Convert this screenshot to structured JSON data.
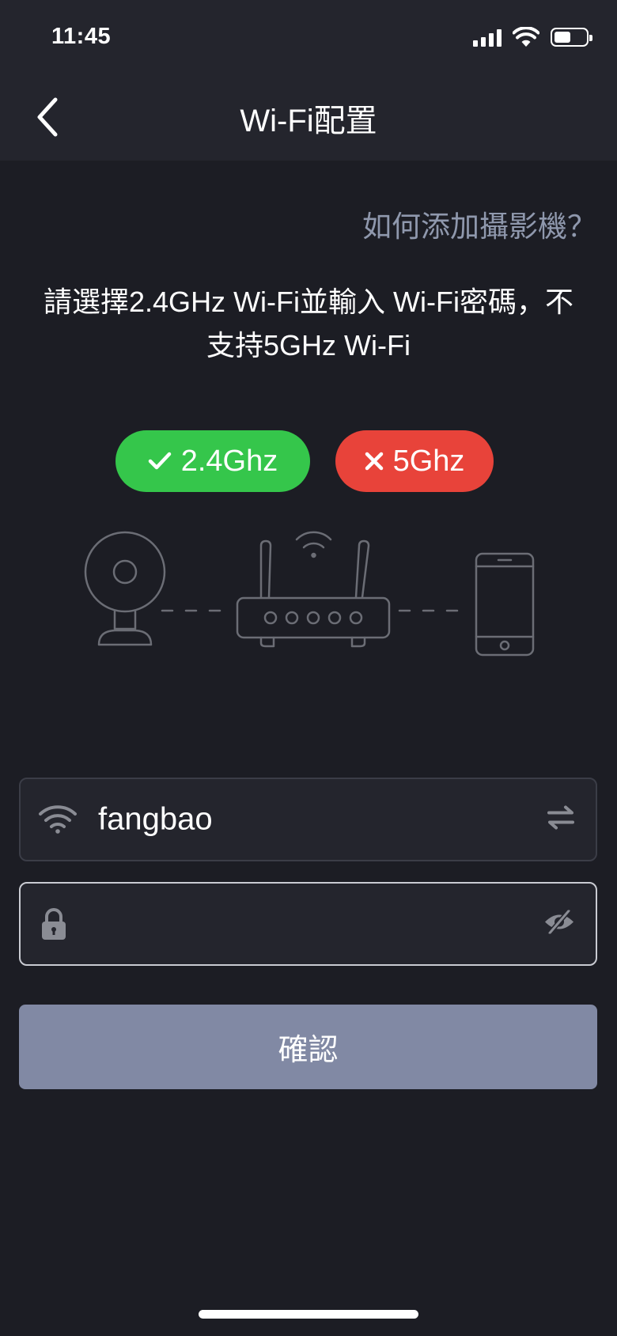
{
  "status_bar": {
    "time": "11:45"
  },
  "nav": {
    "title": "Wi-Fi配置"
  },
  "help_link": "如何添加攝影機？",
  "instruction": "請選擇2.4GHz Wi-Fi並輸入 Wi-Fi密碼，不支持5GHz Wi-Fi",
  "bands": {
    "supported": "2.4Ghz",
    "unsupported": "5Ghz"
  },
  "ssid_field": {
    "value": "fangbao"
  },
  "password_field": {
    "value": "",
    "placeholder": ""
  },
  "confirm_label": "確認",
  "colors": {
    "background": "#1c1d24",
    "header": "#24252d",
    "accent_ok": "#35c64b",
    "accent_bad": "#e8433a",
    "button": "#8189a4",
    "muted": "#8f98ad"
  }
}
